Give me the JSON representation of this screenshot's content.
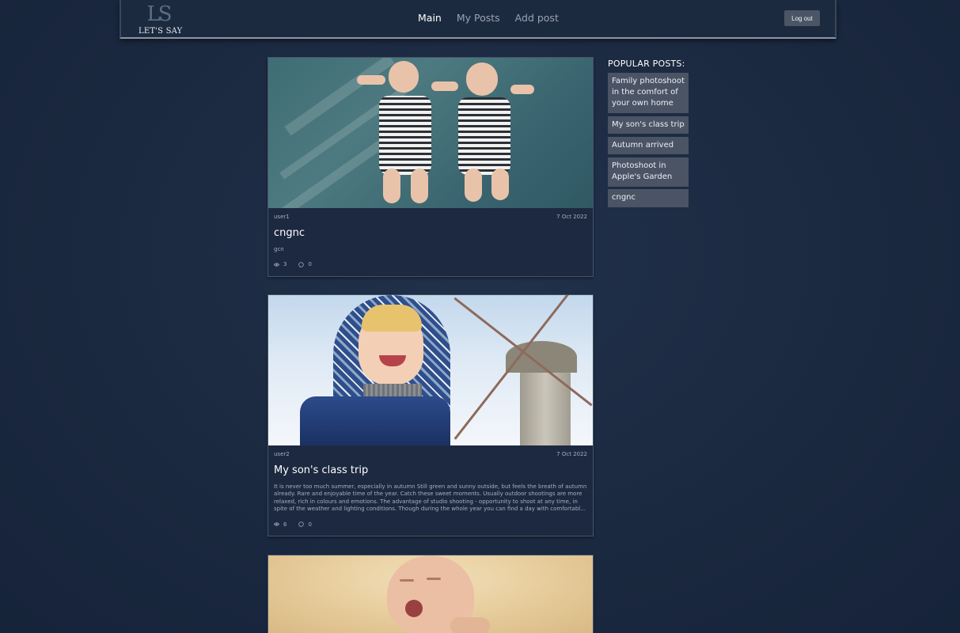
{
  "header": {
    "logo_mark": "LS",
    "logo_text": "LET'S SAY",
    "nav": [
      "Main",
      "My Posts",
      "Add post"
    ],
    "active_nav": "Main",
    "logout_label": "Log out"
  },
  "posts": [
    {
      "author": "user1",
      "date": "7 Oct 2022",
      "title": "cngnc",
      "excerpt": "gcn",
      "views": "3",
      "comments": "0",
      "image": "two-babies-sleeping"
    },
    {
      "author": "user2",
      "date": "7 Oct 2022",
      "title": "My son's class trip",
      "excerpt": "It is never too much summer, especially in autumn Still green and sunny outside, but feels the breath of autumn already. Rare and enjoyable time of the year. Catch these sweet moments. Usually outdoor shootings are more relaxed, rich in colours and emotions. The advantage of studio shooting - opportunity to shoot at any time, in spite of the weather and lighting conditions. Though during the whole year you can find a day with comfortabl...",
      "views": "6",
      "comments": "0",
      "image": "boy-windmill"
    },
    {
      "image": "yawning-baby"
    }
  ],
  "popular": {
    "title": "POPULAR POSTS:",
    "items": [
      "Family photoshoot in the comfort of your own home",
      "My son's class trip",
      "Autumn arrived",
      "Photoshoot in Apple's Garden",
      "cngnc"
    ]
  },
  "icons": {
    "views": "eye-icon",
    "comments": "comment-bubble-icon"
  }
}
